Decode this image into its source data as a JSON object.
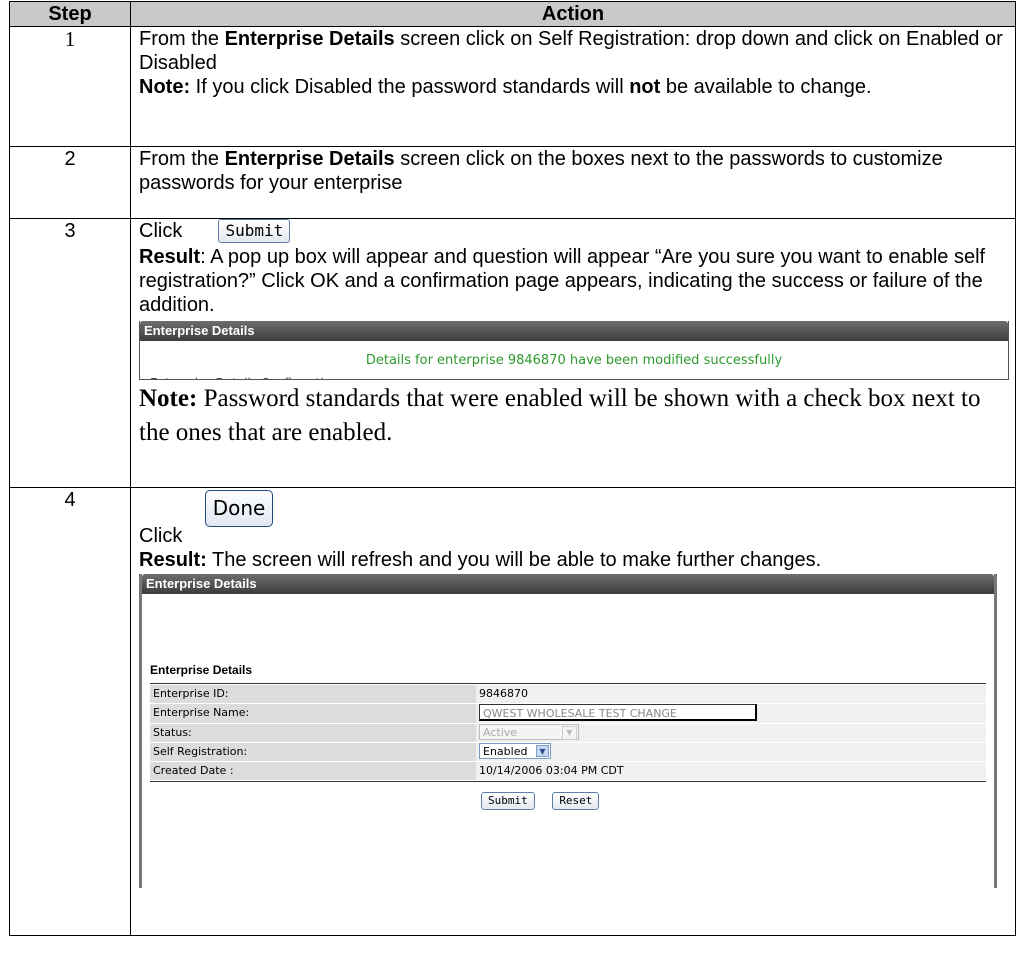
{
  "headers": {
    "step": "Step",
    "action": "Action"
  },
  "step1": {
    "num": "1",
    "t1": "From the ",
    "b1": "Enterprise Details",
    "t2": " screen click on Self Registration: drop down and click on Enabled or Disabled",
    "note_label": "Note:",
    "t3": "  If you click Disabled the password standards will ",
    "b2": "not",
    "t4": " be available to change."
  },
  "step2": {
    "num": "2",
    "t1": "From the ",
    "b1": "Enterprise Details",
    "t2": " screen click on the boxes next to the passwords to customize passwords for your enterprise"
  },
  "step3": {
    "num": "3",
    "click": "Click",
    "submit_label": "Submit",
    "result_label": "Result",
    "result_text": ":  A pop up box will appear and question will appear “Are you sure you want to enable self registration?”  Click OK and a confirmation page appears, indicating the success or failure of the addition.",
    "panel_title": "Enterprise Details",
    "success_msg": "Details for enterprise 9846870 have been modified successfully",
    "cutoff_text": "Enterprise Details Confirmation",
    "note_label": "Note:",
    "note_text": " Password standards that were enabled will be shown with a check box next to the ones that are enabled."
  },
  "step4": {
    "num": "4",
    "done_label": "Done",
    "click": "Click",
    "result_label": "Result:",
    "result_text": "  The screen will refresh and you will be able to make further changes.",
    "panel_title": "Enterprise Details",
    "section_title": "Enterprise Details",
    "rows": [
      {
        "label": "Enterprise ID:",
        "value": "9846870"
      },
      {
        "label": "Enterprise Name:",
        "value": "QWEST WHOLESALE TEST CHANGE"
      },
      {
        "label": "Status:",
        "value": "Active"
      },
      {
        "label": "Self Registration:",
        "value": "Enabled"
      },
      {
        "label": "Created Date :",
        "value": "10/14/2006 03:04 PM CDT"
      }
    ],
    "submit_label": "Submit",
    "reset_label": "Reset"
  }
}
